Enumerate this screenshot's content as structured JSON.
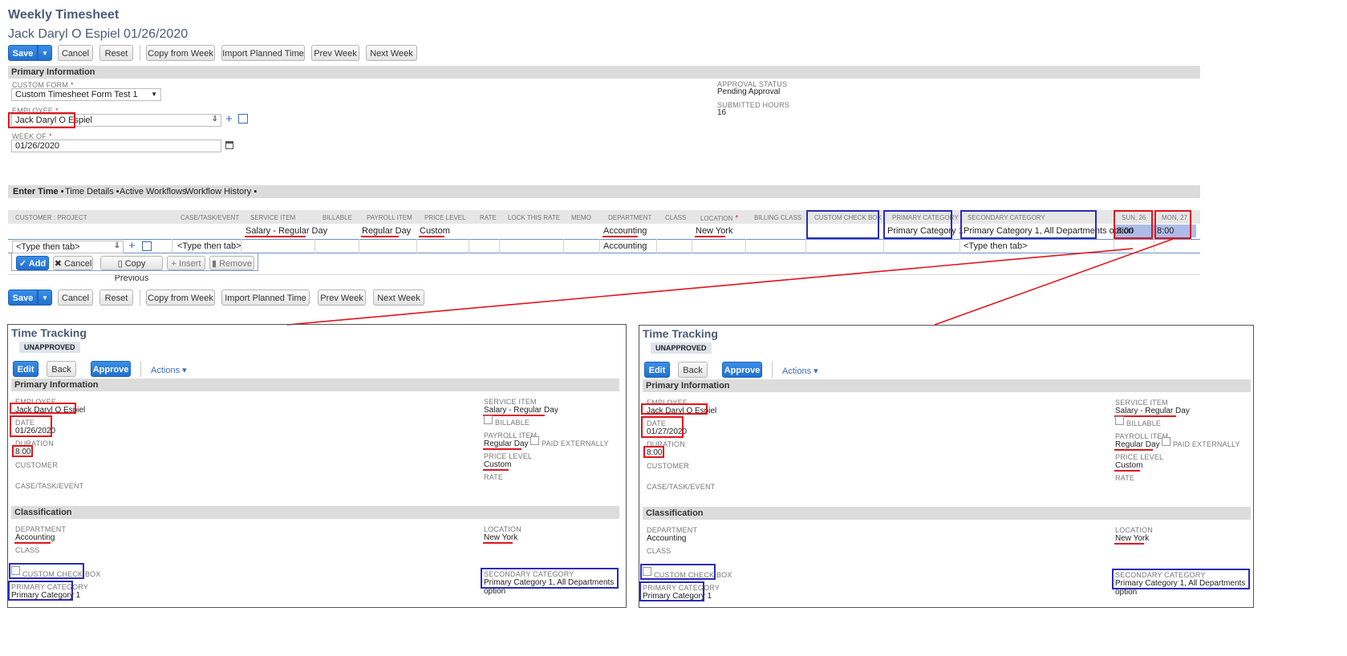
{
  "page": {
    "title": "Weekly Timesheet",
    "subtitle": "Jack Daryl O Espiel 01/26/2020"
  },
  "toolbar": {
    "save": "Save",
    "cancel": "Cancel",
    "reset": "Reset",
    "copy_from_week": "Copy from Week",
    "import_planned": "Import Planned Time",
    "prev_week": "Prev Week",
    "next_week": "Next Week"
  },
  "primary_info": {
    "section": "Primary Information",
    "custom_form_label": "CUSTOM FORM",
    "custom_form_value": "Custom Timesheet Form Test 1",
    "employee_label": "EMPLOYEE",
    "employee_value": "Jack Daryl O Espiel",
    "week_of_label": "WEEK OF",
    "week_of_value": "01/26/2020",
    "approval_status_label": "APPROVAL STATUS",
    "approval_status_value": "Pending Approval",
    "submitted_hours_label": "SUBMITTED HOURS",
    "submitted_hours_value": "16",
    "required_mark": "*"
  },
  "tabs": [
    "Enter Time",
    "Time Details",
    "Active Workflows",
    "Workflow History"
  ],
  "grid": {
    "headers": [
      "CUSTOMER : PROJECT",
      "CASE/TASK/EVENT",
      "SERVICE ITEM",
      "BILLABLE",
      "PAYROLL ITEM",
      "PRICE LEVEL",
      "RATE",
      "LOCK THIS RATE",
      "MEMO",
      "DEPARTMENT",
      "CLASS",
      "LOCATION",
      "BILLING CLASS",
      "CUSTOM CHECK BOX",
      "PRIMARY CATEGORY",
      "SECONDARY CATEGORY",
      "SUN, 26",
      "MON, 27"
    ],
    "row1": {
      "service_item": "Salary - Regular Day",
      "payroll_item": "Regular Day",
      "price_level": "Custom",
      "department": "Accounting",
      "location": "New York",
      "primary_category": "Primary Category 1",
      "secondary_category": "Primary Category 1, All Departments option",
      "sun": "8:00",
      "mon": "8:00"
    },
    "row2": {
      "customer_placeholder": "<Type then tab>",
      "case_placeholder": "<Type then tab>",
      "department": "Accounting",
      "secondary_placeholder": "<Type then tab>"
    },
    "actions": {
      "add": "Add",
      "cancel": "Cancel",
      "copy_previous": "Copy Previous",
      "insert": "Insert",
      "remove": "Remove"
    }
  },
  "time_tracking": [
    {
      "title": "Time Tracking",
      "status": "UNAPPROVED",
      "buttons": {
        "edit": "Edit",
        "back": "Back",
        "approve": "Approve",
        "actions": "Actions"
      },
      "primary_section": "Primary Information",
      "employee_label": "EMPLOYEE",
      "employee": "Jack Daryl O Espiel",
      "date_label": "DATE",
      "date": "01/26/2020",
      "duration_label": "DURATION",
      "duration": "8:00",
      "customer_label": "CUSTOMER",
      "case_label": "CASE/TASK/EVENT",
      "service_item_label": "SERVICE ITEM",
      "service_item": "Salary - Regular Day",
      "billable_label": "BILLABLE",
      "payroll_item_label": "PAYROLL ITEM",
      "payroll_item": "Regular Day",
      "paid_externally_label": "PAID EXTERNALLY",
      "price_level_label": "PRICE LEVEL",
      "price_level": "Custom",
      "rate_label": "RATE",
      "class_section": "Classification",
      "department_label": "DEPARTMENT",
      "department": "Accounting",
      "class_label": "CLASS",
      "custom_check_label": "CUSTOM CHECK BOX",
      "primary_category_label": "PRIMARY CATEGORY",
      "primary_category": "Primary Category 1",
      "location_label": "LOCATION",
      "location": "New York",
      "secondary_category_label": "SECONDARY CATEGORY",
      "secondary_category": "Primary Category 1, All Departments option"
    },
    {
      "title": "Time Tracking",
      "status": "UNAPPROVED",
      "buttons": {
        "edit": "Edit",
        "back": "Back",
        "approve": "Approve",
        "actions": "Actions"
      },
      "primary_section": "Primary Information",
      "employee_label": "EMPLOYEE",
      "employee": "Jack Daryl O Espiel",
      "date_label": "DATE",
      "date": "01/27/2020",
      "duration_label": "DURATION",
      "duration": "8:00",
      "customer_label": "CUSTOMER",
      "case_label": "CASE/TASK/EVENT",
      "service_item_label": "SERVICE ITEM",
      "service_item": "Salary - Regular Day",
      "billable_label": "BILLABLE",
      "payroll_item_label": "PAYROLL ITEM",
      "payroll_item": "Regular Day",
      "paid_externally_label": "PAID EXTERNALLY",
      "price_level_label": "PRICE LEVEL",
      "price_level": "Custom",
      "rate_label": "RATE",
      "class_section": "Classification",
      "department_label": "DEPARTMENT",
      "department": "Accounting",
      "class_label": "CLASS",
      "custom_check_label": "CUSTOM CHECK BOX",
      "primary_category_label": "PRIMARY CATEGORY",
      "primary_category": "Primary Category 1",
      "location_label": "LOCATION",
      "location": "New York",
      "secondary_category_label": "SECONDARY CATEGORY",
      "secondary_category": "Primary Category 1, All Departments option"
    }
  ],
  "colors": {
    "accent": "#2270d1",
    "highlight_red": "#e0141e",
    "highlight_blue": "#2b2bb8",
    "title": "#4a5a78"
  }
}
